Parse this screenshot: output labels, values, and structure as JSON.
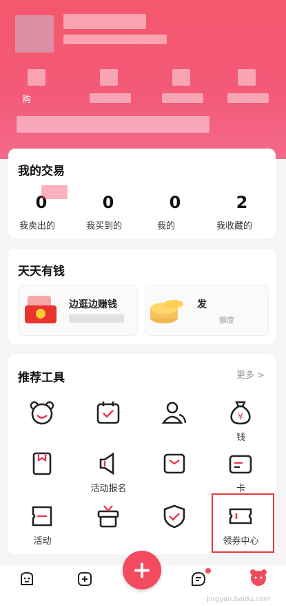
{
  "header": {
    "buy_label": "购"
  },
  "transactions": {
    "title": "我的交易",
    "items": [
      {
        "count": "0",
        "label": "我卖出的"
      },
      {
        "count": "0",
        "label": "我买到的"
      },
      {
        "count": "0",
        "label": "我的"
      },
      {
        "count": "2",
        "label": "我收藏的"
      }
    ]
  },
  "earn": {
    "title": "天天有钱",
    "items": [
      {
        "title": "边逛边赚钱",
        "sub": ""
      },
      {
        "title": "发",
        "sub": "额度"
      }
    ]
  },
  "tools": {
    "title": "推荐工具",
    "more": "更多 >",
    "items": [
      {
        "label": "",
        "icon": "bear-face-icon"
      },
      {
        "label": "",
        "icon": "calendar-check-icon"
      },
      {
        "label": "",
        "icon": "people-icon"
      },
      {
        "label": "钱",
        "icon": "money-bag-icon"
      },
      {
        "label": "",
        "icon": "bookmark-icon"
      },
      {
        "label": "活动报名",
        "icon": "speaker-icon"
      },
      {
        "label": "",
        "icon": "envelope-icon"
      },
      {
        "label": "卡",
        "icon": "card-icon"
      },
      {
        "label": "活动",
        "icon": "ticket-frame-icon"
      },
      {
        "label": "",
        "icon": "gift-box-icon"
      },
      {
        "label": "",
        "icon": "shield-check-icon"
      },
      {
        "label": "领券中心",
        "icon": "coupon-icon"
      }
    ]
  },
  "bottom_nav": {
    "items": [
      {
        "icon": "smiley-icon"
      },
      {
        "icon": "add-square-icon"
      },
      {
        "icon": "plus-icon"
      },
      {
        "icon": "message-icon"
      },
      {
        "icon": "bear-avatar-icon"
      }
    ]
  },
  "watermark": "jingyan.baidu.com",
  "colors": {
    "brand": "#f5576c",
    "accent": "#f24b5f",
    "highlight": "#e53935"
  }
}
